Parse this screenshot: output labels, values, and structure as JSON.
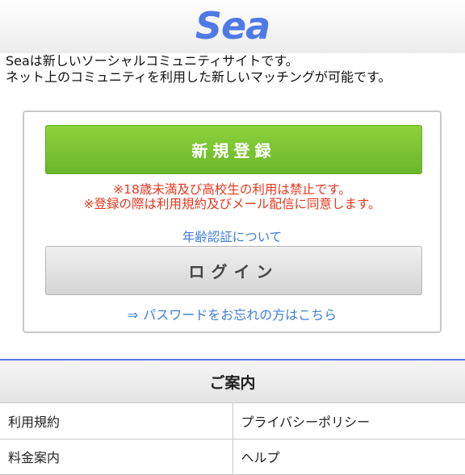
{
  "header": {
    "logo": "Sea"
  },
  "intro": {
    "line1": "Seaは新しいソーシャルコミュニティサイトです。",
    "line2": "ネット上のコミュニティを利用した新しいマッチングが可能です。"
  },
  "panel": {
    "register_label": "新規登録",
    "warning1": "※18歳未満及び高校生の利用は禁止です。",
    "warning2": "※登録の際は利用規約及びメール配信に同意します。",
    "age_verification_link": "年齢認証について",
    "login_label": "ログイン",
    "forgot_arrow": "⇒",
    "forgot_password_link": "パスワードをお忘れの方はこちら"
  },
  "guide": {
    "title": "ご案内",
    "items": [
      {
        "label": "利用規約"
      },
      {
        "label": "プライバシーポリシー"
      },
      {
        "label": "料金案内"
      },
      {
        "label": "ヘルプ"
      }
    ]
  },
  "colors": {
    "brand": "#4f79e6",
    "register_green": "#78c22f",
    "warning_red": "#e8361e",
    "link_blue": "#3f7ed6"
  }
}
